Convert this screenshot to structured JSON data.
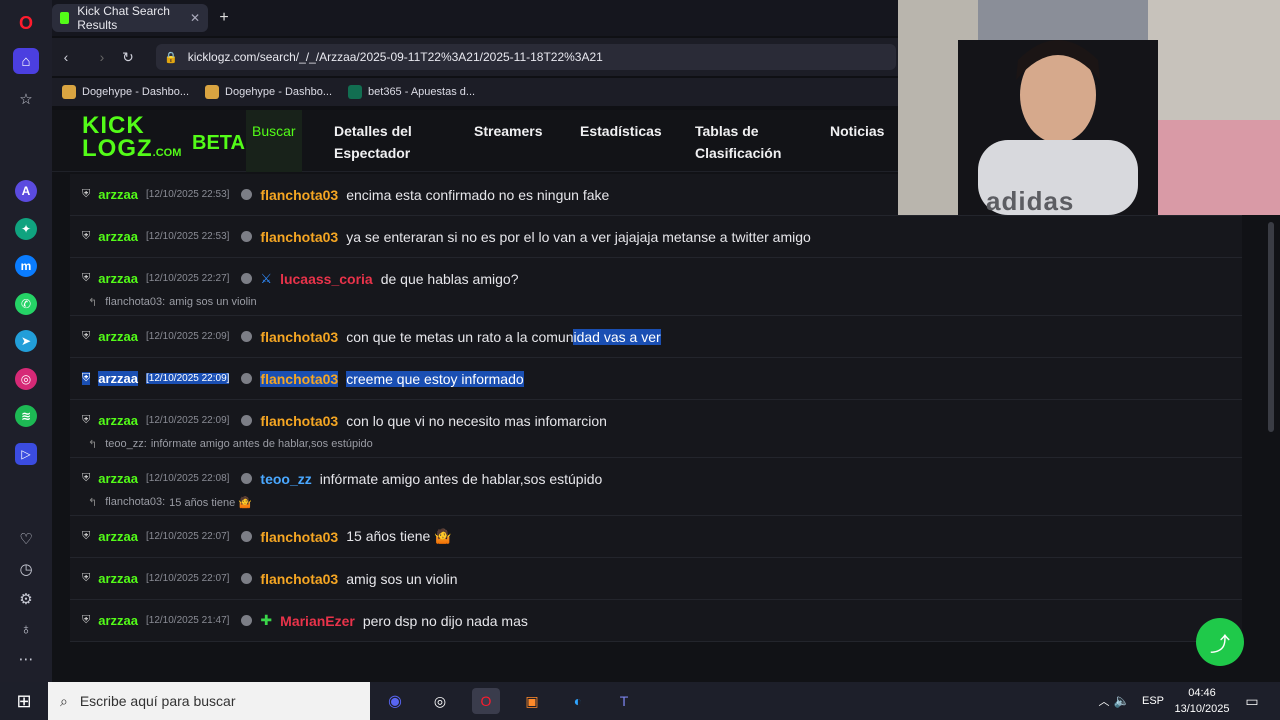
{
  "browser": {
    "tab_title": "Kick Chat Search Results",
    "url": "kicklogz.com/search/_/_/Arzzaa/2025-09-11T22%3A21/2025-11-18T22%3A21",
    "bookmarks": [
      "Dogehype - Dashbo...",
      "Dogehype - Dashbo...",
      "bet365 - Apuestas d..."
    ]
  },
  "site": {
    "logo_top": "KICK",
    "logo_bottom": "LOGZ",
    "logo_suffix": ".COM",
    "beta": "BETA",
    "nav": [
      "Buscar",
      "Detalles del\nEspectador",
      "Streamers",
      "Estadísticas",
      "Tablas de\nClasificación",
      "Noticias"
    ]
  },
  "messages": [
    {
      "channel": "arzzaa",
      "time": "[12/10/2025 22:53]",
      "sender": "flanchota03",
      "sender_color": "#f5a623",
      "text": "encima esta confirmado no es ningun fake"
    },
    {
      "channel": "arzzaa",
      "time": "[12/10/2025 22:53]",
      "sender": "flanchota03",
      "sender_color": "#f5a623",
      "text": "ya se enteraran si no es por el lo van a ver jajajaja metanse a twitter amigo"
    },
    {
      "channel": "arzzaa",
      "time": "[12/10/2025 22:27]",
      "sender": "lucaass_coria",
      "sender_color": "#e8334a",
      "text": "de que hablas amigo?",
      "reply_user": "flanchota03:",
      "reply_text": "amig sos un violin"
    },
    {
      "channel": "arzzaa",
      "time": "[12/10/2025 22:09]",
      "sender": "flanchota03",
      "sender_color": "#f5a623",
      "text_plain": "con que te metas un rato a la comun",
      "text_hl": "idad vas a ver"
    },
    {
      "channel": "arzzaa",
      "time": "[12/10/2025 22:09]",
      "sender": "flanchota03",
      "sender_color": "#f5a623",
      "text": "creeme que estoy informado"
    },
    {
      "channel": "arzzaa",
      "time": "[12/10/2025 22:09]",
      "sender": "flanchota03",
      "sender_color": "#f5a623",
      "text": "con lo que vi no necesito mas infomarcion",
      "reply_user": "teoo_zz:",
      "reply_text": "infórmate amigo antes de hablar,sos estúpido"
    },
    {
      "channel": "arzzaa",
      "time": "[12/10/2025 22:08]",
      "sender": "teoo_zz",
      "sender_color": "#4aa8ff",
      "text": "infórmate amigo antes de hablar,sos estúpido",
      "reply_user": "flanchota03:",
      "reply_text": "15 años tiene 🤷"
    },
    {
      "channel": "arzzaa",
      "time": "[12/10/2025 22:07]",
      "sender": "flanchota03",
      "sender_color": "#f5a623",
      "text": "15 años tiene 🤷"
    },
    {
      "channel": "arzzaa",
      "time": "[12/10/2025 22:07]",
      "sender": "flanchota03",
      "sender_color": "#f5a623",
      "text": "amig sos un violin"
    },
    {
      "channel": "arzzaa",
      "time": "[12/10/2025 21:47]",
      "sender": "MarianEzer",
      "sender_color": "#e8334a",
      "text": "pero dsp no dijo nada mas"
    }
  ],
  "taskbar": {
    "search_placeholder": "Escribe aquí para buscar",
    "lang": "ESP",
    "time": "04:46",
    "date": "13/10/2025"
  },
  "webcam": {
    "shirt_text": "adidas"
  },
  "colors": {
    "kick_green": "#53fc18",
    "bg": "#111216"
  }
}
